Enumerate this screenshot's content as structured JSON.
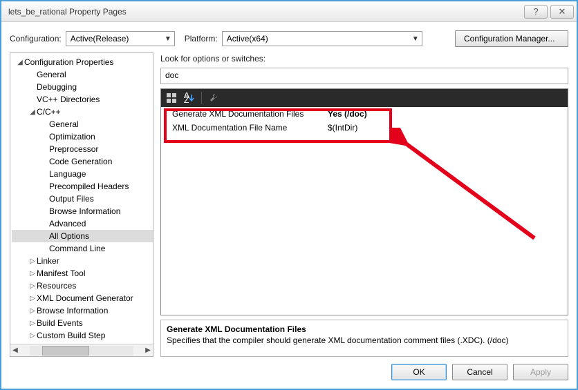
{
  "window": {
    "title": "lets_be_rational Property Pages"
  },
  "toolbar": {
    "config_label": "Configuration:",
    "config_value": "Active(Release)",
    "platform_label": "Platform:",
    "platform_value": "Active(x64)",
    "config_mgr": "Configuration Manager..."
  },
  "tree": {
    "root": "Configuration Properties",
    "items": [
      {
        "l": "General",
        "d": 1
      },
      {
        "l": "Debugging",
        "d": 1
      },
      {
        "l": "VC++ Directories",
        "d": 1
      },
      {
        "l": "C/C++",
        "d": 1,
        "exp": true
      },
      {
        "l": "General",
        "d": 2
      },
      {
        "l": "Optimization",
        "d": 2
      },
      {
        "l": "Preprocessor",
        "d": 2
      },
      {
        "l": "Code Generation",
        "d": 2
      },
      {
        "l": "Language",
        "d": 2
      },
      {
        "l": "Precompiled Headers",
        "d": 2
      },
      {
        "l": "Output Files",
        "d": 2
      },
      {
        "l": "Browse Information",
        "d": 2
      },
      {
        "l": "Advanced",
        "d": 2
      },
      {
        "l": "All Options",
        "d": 2,
        "sel": true
      },
      {
        "l": "Command Line",
        "d": 2
      },
      {
        "l": "Linker",
        "d": 1,
        "col": true
      },
      {
        "l": "Manifest Tool",
        "d": 1,
        "col": true
      },
      {
        "l": "Resources",
        "d": 1,
        "col": true
      },
      {
        "l": "XML Document Generator",
        "d": 1,
        "col": true
      },
      {
        "l": "Browse Information",
        "d": 1,
        "col": true
      },
      {
        "l": "Build Events",
        "d": 1,
        "col": true
      },
      {
        "l": "Custom Build Step",
        "d": 1,
        "col": true
      }
    ]
  },
  "search": {
    "label": "Look for options or switches:",
    "value": "doc"
  },
  "grid": {
    "rows": [
      {
        "name": "Generate XML Documentation Files",
        "value": "Yes (/doc)",
        "bold": true
      },
      {
        "name": "XML Documentation File Name",
        "value": "$(IntDir)"
      }
    ]
  },
  "desc": {
    "title": "Generate XML Documentation Files",
    "text": "Specifies that the compiler should generate XML documentation comment files (.XDC).     (/doc)"
  },
  "buttons": {
    "ok": "OK",
    "cancel": "Cancel",
    "apply": "Apply"
  }
}
